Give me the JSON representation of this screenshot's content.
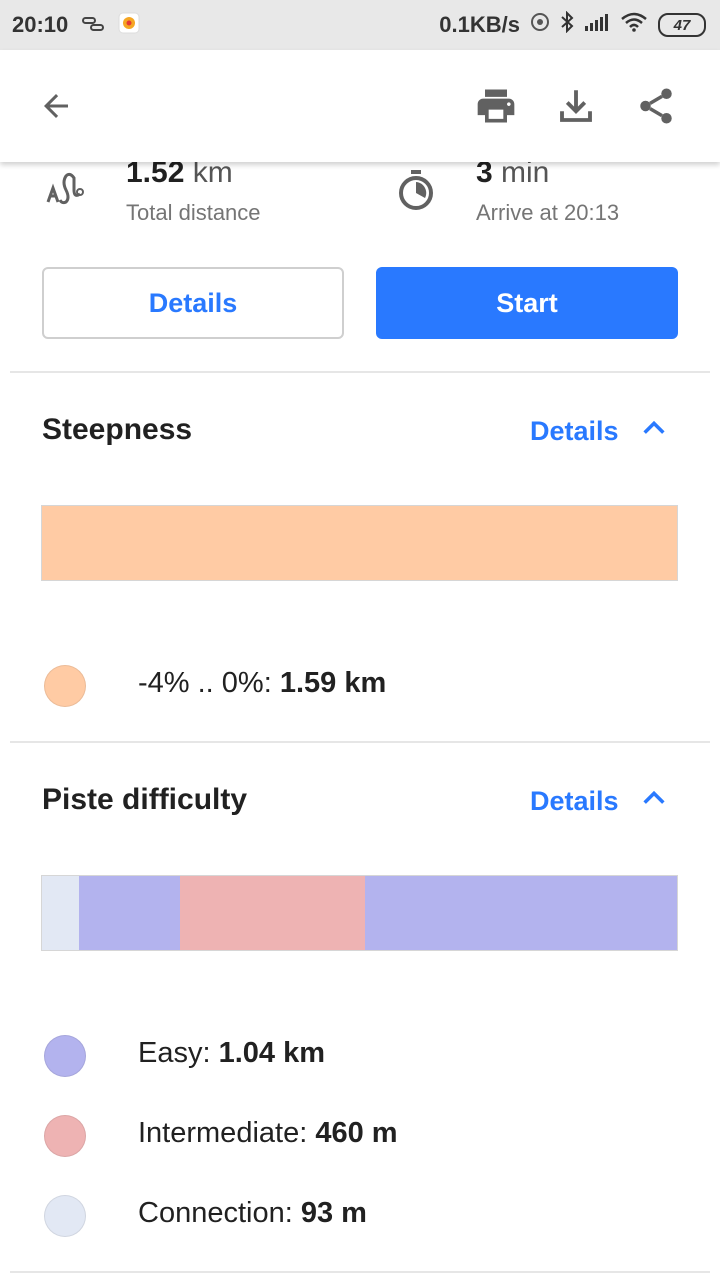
{
  "status_bar": {
    "time": "20:10",
    "net_speed": "0.1KB/s",
    "battery": "47"
  },
  "summary": {
    "distance_value": "1.52",
    "distance_unit": "km",
    "distance_label": "Total distance",
    "time_value": "3",
    "time_unit": "min",
    "time_label": "Arrive at 20:13"
  },
  "actions": {
    "details_label": "Details",
    "start_label": "Start"
  },
  "steepness": {
    "title": "Steepness",
    "details_label": "Details",
    "bar_segments": [
      {
        "color": "#ffcba4",
        "fraction": 1.0
      }
    ],
    "legend": [
      {
        "color": "#ffcba4",
        "label": "-4% .. 0%: ",
        "value": "1.59 km"
      }
    ]
  },
  "piste": {
    "title": "Piste difficulty",
    "details_label": "Details",
    "bar_segments": [
      {
        "color": "#e2e8f4",
        "fraction": 0.058
      },
      {
        "color": "#b3b3ee",
        "fraction": 0.16
      },
      {
        "color": "#eeb3b3",
        "fraction": 0.29
      },
      {
        "color": "#b3b3ee",
        "fraction": 0.492
      }
    ],
    "legend": [
      {
        "color": "#b3b3ee",
        "label": "Easy: ",
        "value": "1.04 km"
      },
      {
        "color": "#eeb3b3",
        "label": "Intermediate: ",
        "value": "460 m"
      },
      {
        "color": "#e2e8f4",
        "label": "Connection: ",
        "value": "93 m"
      }
    ]
  },
  "colors": {
    "accent": "#2979ff"
  }
}
